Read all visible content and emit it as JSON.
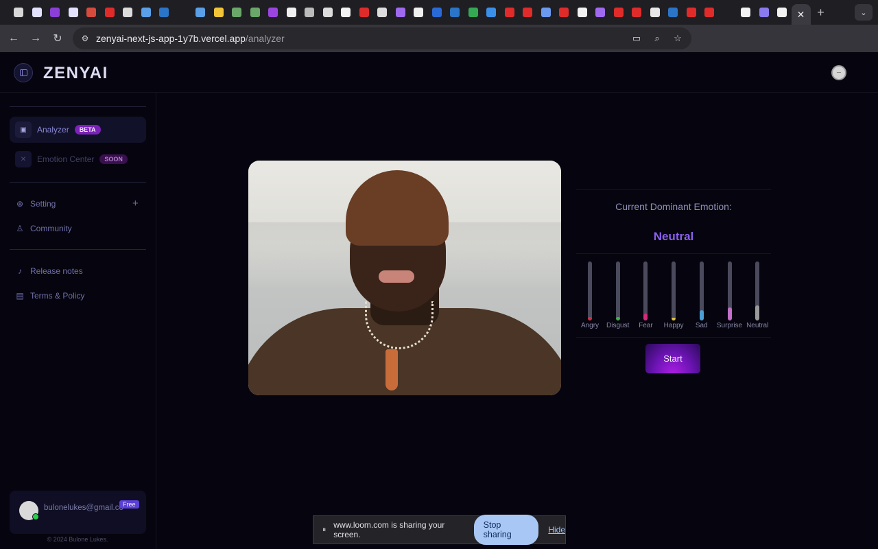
{
  "browser": {
    "tab_favicons": [
      {
        "icon": "chrome-icon",
        "color": "#d8d8d8"
      },
      {
        "icon": "stack-icon",
        "color": "#e2e2ff"
      },
      {
        "icon": "z-icon",
        "color": "#8b3fd8"
      },
      {
        "icon": "stack-icon",
        "color": "#e2e2ff"
      },
      {
        "icon": "gmail-icon",
        "color": "#d54b3d"
      },
      {
        "icon": "youtube-icon",
        "color": "#e02b2b"
      },
      {
        "icon": "bug-icon",
        "color": "#dcdcdc"
      },
      {
        "icon": "headphones-icon",
        "color": "#5aa0e8"
      },
      {
        "icon": "linkedin-icon",
        "color": "#2a75c8"
      },
      {
        "icon": "blank-icon",
        "color": "#1f1f23"
      },
      {
        "icon": "headphones-icon",
        "color": "#5aa0e8"
      },
      {
        "icon": "hugging-icon",
        "color": "#f3c536"
      },
      {
        "icon": "blob-icon",
        "color": "#6aa86a"
      },
      {
        "icon": "blob-icon",
        "color": "#6aa86a"
      },
      {
        "icon": "s-icon",
        "color": "#9b45e0"
      },
      {
        "icon": "i-icon",
        "color": "#f0f0f0"
      },
      {
        "icon": "ai-icon",
        "color": "#bbbbbb"
      },
      {
        "icon": "bug-icon",
        "color": "#dcdcdc"
      },
      {
        "icon": "triangle-icon",
        "color": "#f2f2f2"
      },
      {
        "icon": "youtube-icon",
        "color": "#e02b2b"
      },
      {
        "icon": "cloud-icon",
        "color": "#dddddd"
      },
      {
        "icon": "compass-icon",
        "color": "#a06af0"
      },
      {
        "icon": "r-icon",
        "color": "#f0f0f0"
      },
      {
        "icon": "cb-icon",
        "color": "#2a6ad8"
      },
      {
        "icon": "linkedin-icon",
        "color": "#2a75c8"
      },
      {
        "icon": "maps-icon",
        "color": "#34a853"
      },
      {
        "icon": "v-icon",
        "color": "#3a90e8"
      },
      {
        "icon": "youtube-icon",
        "color": "#e02b2b"
      },
      {
        "icon": "youtube-icon",
        "color": "#e02b2b"
      },
      {
        "icon": "gemini-icon",
        "color": "#6a9af0"
      },
      {
        "icon": "youtube-icon",
        "color": "#e02b2b"
      },
      {
        "icon": "triangle-icon",
        "color": "#f2f2f2"
      },
      {
        "icon": "compass-icon",
        "color": "#a06af0"
      },
      {
        "icon": "youtube-icon",
        "color": "#e02b2b"
      },
      {
        "icon": "youtube-icon",
        "color": "#e02b2b"
      },
      {
        "icon": "google-icon",
        "color": "#e8e8e8"
      },
      {
        "icon": "linkedin-icon",
        "color": "#2a75c8"
      },
      {
        "icon": "youtube-icon",
        "color": "#e02b2b"
      },
      {
        "icon": "youtube-icon",
        "color": "#e02b2b"
      },
      {
        "icon": "blank-icon",
        "color": "#1f1f23"
      },
      {
        "icon": "triangle-icon",
        "color": "#f2f2f2"
      },
      {
        "icon": "gear-icon",
        "color": "#8a7af0"
      },
      {
        "icon": "triangle-icon",
        "color": "#f2f2f2"
      }
    ],
    "active_tab_close": "✕",
    "new_tab": "+",
    "url_host": "zenyai-next-js-app-1y7b.vercel.app",
    "url_path": "/analyzer"
  },
  "app": {
    "brand": "ZENYAI",
    "sidebar": {
      "analyzer_label": "Analyzer",
      "analyzer_badge": "BETA",
      "emotion_center_label": "Emotion Center",
      "emotion_center_badge": "SOON",
      "setting_label": "Setting",
      "community_label": "Community",
      "release_notes_label": "Release notes",
      "terms_label": "Terms & Policy",
      "user_email": "bulonelukes@gmail.com",
      "plan_badge": "Free",
      "copyright": "© 2024 Bulone Lukes."
    },
    "emotion_panel": {
      "title": "Current Dominant Emotion:",
      "dominant": "Neutral",
      "emotions": [
        {
          "label": "Angry",
          "level": 0.06,
          "color": "#d0304a"
        },
        {
          "label": "Disgust",
          "level": 0.06,
          "color": "#3fb24a"
        },
        {
          "label": "Fear",
          "level": 0.12,
          "color": "#d62a7a"
        },
        {
          "label": "Happy",
          "level": 0.02,
          "color": "#e0c040"
        },
        {
          "label": "Sad",
          "level": 0.18,
          "color": "#4aa0d6"
        },
        {
          "label": "Surprise",
          "level": 0.22,
          "color": "#c070c8"
        },
        {
          "label": "Neutral",
          "level": 0.26,
          "color": "#9a9a9a"
        }
      ],
      "start_button": "Start"
    },
    "screen_share": {
      "message": "www.loom.com is sharing your screen.",
      "stop_button": "Stop sharing",
      "hide_link": "Hide"
    }
  }
}
